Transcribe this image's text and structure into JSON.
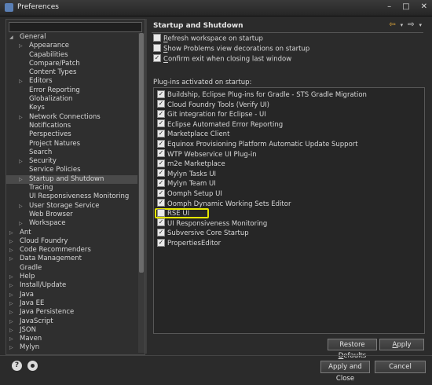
{
  "window": {
    "title": "Preferences"
  },
  "filter": {
    "value": "",
    "placeholder": ""
  },
  "tree": [
    {
      "label": "General",
      "level": 0,
      "expandable": false,
      "expanded": true,
      "selected": false
    },
    {
      "label": "Appearance",
      "level": 1,
      "expandable": true,
      "selected": false
    },
    {
      "label": "Capabilities",
      "level": 1,
      "expandable": false,
      "selected": false
    },
    {
      "label": "Compare/Patch",
      "level": 1,
      "expandable": false,
      "selected": false
    },
    {
      "label": "Content Types",
      "level": 1,
      "expandable": false,
      "selected": false
    },
    {
      "label": "Editors",
      "level": 1,
      "expandable": true,
      "selected": false
    },
    {
      "label": "Error Reporting",
      "level": 1,
      "expandable": false,
      "selected": false
    },
    {
      "label": "Globalization",
      "level": 1,
      "expandable": false,
      "selected": false
    },
    {
      "label": "Keys",
      "level": 1,
      "expandable": false,
      "selected": false
    },
    {
      "label": "Network Connections",
      "level": 1,
      "expandable": true,
      "selected": false
    },
    {
      "label": "Notifications",
      "level": 1,
      "expandable": false,
      "selected": false
    },
    {
      "label": "Perspectives",
      "level": 1,
      "expandable": false,
      "selected": false
    },
    {
      "label": "Project Natures",
      "level": 1,
      "expandable": false,
      "selected": false
    },
    {
      "label": "Search",
      "level": 1,
      "expandable": false,
      "selected": false
    },
    {
      "label": "Security",
      "level": 1,
      "expandable": true,
      "selected": false
    },
    {
      "label": "Service Policies",
      "level": 1,
      "expandable": false,
      "selected": false
    },
    {
      "label": "Startup and Shutdown",
      "level": 1,
      "expandable": true,
      "selected": true
    },
    {
      "label": "Tracing",
      "level": 1,
      "expandable": false,
      "selected": false
    },
    {
      "label": "UI Responsiveness Monitoring",
      "level": 1,
      "expandable": false,
      "selected": false
    },
    {
      "label": "User Storage Service",
      "level": 1,
      "expandable": true,
      "selected": false
    },
    {
      "label": "Web Browser",
      "level": 1,
      "expandable": false,
      "selected": false
    },
    {
      "label": "Workspace",
      "level": 1,
      "expandable": true,
      "selected": false
    },
    {
      "label": "Ant",
      "level": 0,
      "expandable": true,
      "selected": false
    },
    {
      "label": "Cloud Foundry",
      "level": 0,
      "expandable": true,
      "selected": false
    },
    {
      "label": "Code Recommenders",
      "level": 0,
      "expandable": true,
      "selected": false
    },
    {
      "label": "Data Management",
      "level": 0,
      "expandable": true,
      "selected": false
    },
    {
      "label": "Gradle",
      "level": 0,
      "expandable": false,
      "selected": false
    },
    {
      "label": "Help",
      "level": 0,
      "expandable": true,
      "selected": false
    },
    {
      "label": "Install/Update",
      "level": 0,
      "expandable": true,
      "selected": false
    },
    {
      "label": "Java",
      "level": 0,
      "expandable": true,
      "selected": false
    },
    {
      "label": "Java EE",
      "level": 0,
      "expandable": true,
      "selected": false
    },
    {
      "label": "Java Persistence",
      "level": 0,
      "expandable": true,
      "selected": false
    },
    {
      "label": "JavaScript",
      "level": 0,
      "expandable": true,
      "selected": false
    },
    {
      "label": "JSON",
      "level": 0,
      "expandable": true,
      "selected": false
    },
    {
      "label": "Maven",
      "level": 0,
      "expandable": true,
      "selected": false
    },
    {
      "label": "Mylyn",
      "level": 0,
      "expandable": true,
      "selected": false
    }
  ],
  "page": {
    "title": "Startup and Shutdown",
    "options": [
      {
        "label": "Refresh workspace on startup",
        "mnemonic": "R",
        "rest": "efresh workspace on startup",
        "checked": false
      },
      {
        "label": "Show Problems view decorations on startup",
        "mnemonic": "S",
        "rest": "how Problems view decorations on startup",
        "checked": false
      },
      {
        "label": "Confirm exit when closing last window",
        "mnemonic": "C",
        "rest": "onfirm exit when closing last window",
        "checked": true
      }
    ],
    "plugins_label": "Plug-ins activated on startup:",
    "plugins": [
      {
        "label": "Buildship, Eclipse Plug-ins for Gradle - STS Gradle Migration",
        "checked": true
      },
      {
        "label": "Cloud Foundry Tools (Verify UI)",
        "checked": true
      },
      {
        "label": "Git integration for Eclipse - UI",
        "checked": true
      },
      {
        "label": "Eclipse Automated Error Reporting",
        "checked": true
      },
      {
        "label": "Marketplace Client",
        "checked": true
      },
      {
        "label": "Equinox Provisioning Platform Automatic Update Support",
        "checked": true
      },
      {
        "label": "WTP Webservice UI Plug-in",
        "checked": true
      },
      {
        "label": "m2e Marketplace",
        "checked": true
      },
      {
        "label": "Mylyn Tasks UI",
        "checked": true
      },
      {
        "label": "Mylyn Team UI",
        "checked": true
      },
      {
        "label": "Oomph Setup UI",
        "checked": true
      },
      {
        "label": "Oomph Dynamic Working Sets Editor",
        "checked": true
      },
      {
        "label": "RSE UI",
        "checked": false,
        "highlighted": true
      },
      {
        "label": "UI Responsiveness Monitoring",
        "checked": true
      },
      {
        "label": "Subversive Core Startup",
        "checked": true
      },
      {
        "label": "PropertiesEditor",
        "checked": true
      }
    ],
    "restore_defaults": "Restore Defaults",
    "apply": "Apply"
  },
  "footer": {
    "apply_and_close": "Apply and Close",
    "cancel": "Cancel",
    "help_glyph": "?"
  },
  "colors": {
    "highlight": "#e5e600",
    "selected_row": "#4a4a4a",
    "back_arrow": "#e2a93a"
  },
  "icons": {
    "back": "arrow-left-icon",
    "forward": "arrow-right-icon",
    "menu": "chevron-down-icon",
    "help": "help-icon",
    "import_export": "import-export-icon"
  }
}
